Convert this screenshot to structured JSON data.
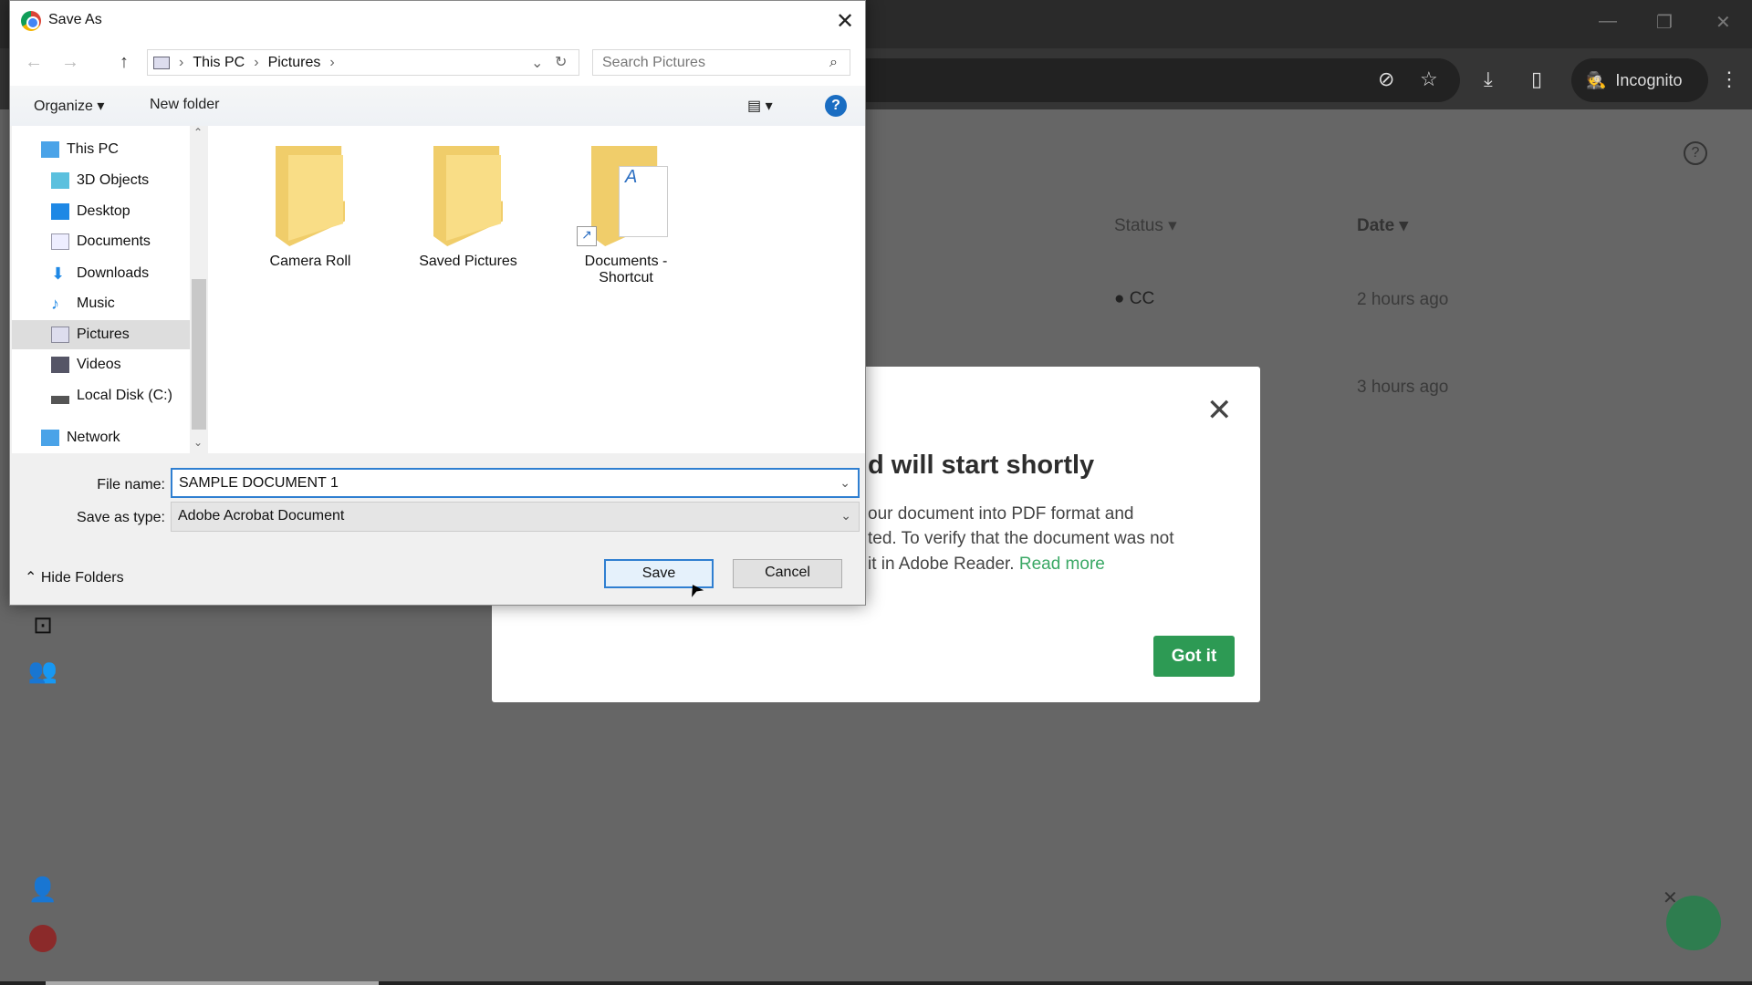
{
  "browser": {
    "incognito_label": "Incognito",
    "window_controls": [
      "minimize-icon",
      "restore-icon",
      "close-icon"
    ],
    "toolbar_icons": [
      "eye-off-icon",
      "star-icon",
      "download-icon",
      "sidebar-icon",
      "menu-icon"
    ]
  },
  "page": {
    "columns": {
      "status": "Status",
      "date": "Date"
    },
    "rows": [
      {
        "status": "CC",
        "date": "2 hours ago"
      },
      {
        "status": "",
        "date": "3 hours ago"
      }
    ],
    "sidebar_icons": [
      "terminal-icon",
      "users-icon",
      "add-user-icon",
      "avatar"
    ]
  },
  "popup": {
    "title": "d will start shortly",
    "lines": [
      "our document into PDF format and",
      "ted. To verify that the document was not",
      "it in Adobe Reader."
    ],
    "read_more": "Read more",
    "got_it": "Got it",
    "accent": "#2d9a54"
  },
  "dialog": {
    "title": "Save As",
    "breadcrumb": [
      "This PC",
      "Pictures"
    ],
    "search_placeholder": "Search Pictures",
    "organize": "Organize",
    "new_folder": "New folder",
    "tree": [
      {
        "label": "This PC"
      },
      {
        "label": "3D Objects"
      },
      {
        "label": "Desktop"
      },
      {
        "label": "Documents"
      },
      {
        "label": "Downloads"
      },
      {
        "label": "Music"
      },
      {
        "label": "Pictures",
        "selected": true
      },
      {
        "label": "Videos"
      },
      {
        "label": "Local Disk (C:)"
      },
      {
        "label": "Network"
      }
    ],
    "items": [
      {
        "label": "Camera Roll"
      },
      {
        "label": "Saved Pictures"
      },
      {
        "label": "Documents - Shortcut"
      }
    ],
    "file_name_label": "File name:",
    "file_name": "SAMPLE DOCUMENT 1",
    "type_label": "Save as type:",
    "type": "Adobe Acrobat Document",
    "hide_folders": "Hide Folders",
    "save": "Save",
    "cancel": "Cancel"
  }
}
